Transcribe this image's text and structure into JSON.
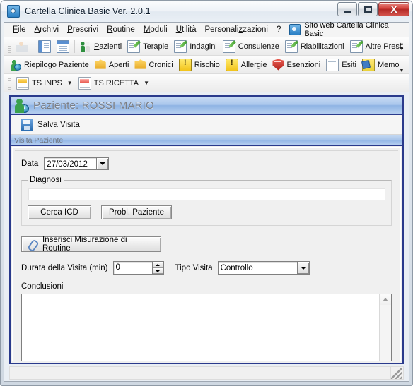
{
  "window": {
    "title": "Cartella Clinica Basic Ver. 2.0.1",
    "app_icon": "app-icon",
    "controls": {
      "minimize": "minimize-button",
      "maximize": "maximize-button",
      "close_glyph": "X"
    }
  },
  "menubar": {
    "items": [
      {
        "label": "File",
        "accel": "F"
      },
      {
        "label": "Archivi",
        "accel": "A"
      },
      {
        "label": "Prescrivi",
        "accel": "P"
      },
      {
        "label": "Routine",
        "accel": "R"
      },
      {
        "label": "Moduli",
        "accel": "M"
      },
      {
        "label": "Utilità",
        "accel": "U"
      },
      {
        "label": "Personalizzazioni",
        "accel": "z"
      },
      {
        "label": "?",
        "accel": ""
      }
    ],
    "web_link": "Sito web Cartella Clinica Basic"
  },
  "toolbar1": {
    "overflow_glyph": "»",
    "items": [
      {
        "label": "",
        "icon": "person-search-icon"
      },
      {
        "label": "",
        "icon": "panel-left-icon"
      },
      {
        "label": "",
        "icon": "panel-top-icon"
      },
      {
        "label": "Pazienti",
        "accel": "P",
        "icon": "people-icon"
      },
      {
        "label": "Terapie",
        "icon": "note-pencil-icon"
      },
      {
        "label": "Indagini",
        "icon": "note-pencil-icon"
      },
      {
        "label": "Consulenze",
        "icon": "note-pencil-icon"
      },
      {
        "label": "Riabilitazioni",
        "icon": "note-pencil-icon"
      },
      {
        "label": "Altre Prest.",
        "icon": "note-pencil-icon"
      }
    ]
  },
  "toolbar2": {
    "items": [
      {
        "label": "Riepilogo Paziente",
        "icon": "patient-summary-icon"
      },
      {
        "label": "Aperti",
        "icon": "folder-icon"
      },
      {
        "label": "Cronici",
        "icon": "folder-icon"
      },
      {
        "label": "Rischio",
        "icon": "warning-icon"
      },
      {
        "label": "Allergie",
        "icon": "warning-icon"
      },
      {
        "label": "Esenzioni",
        "icon": "shield-icon"
      },
      {
        "label": "Esiti",
        "icon": "document-icon"
      },
      {
        "label": "Memo",
        "icon": "memo-icon"
      }
    ]
  },
  "toolbar3": {
    "items": [
      {
        "label": "TS INPS",
        "icon": "card-yellow-icon",
        "has_dropdown": true
      },
      {
        "label": "TS RICETTA",
        "icon": "card-red-icon",
        "has_dropdown": true
      }
    ]
  },
  "patient_header": {
    "title": "Paziente: ROSSI MARIO",
    "icon": "patient-info-icon"
  },
  "save_bar": {
    "label": "Salva Visita",
    "accel": "V",
    "icon": "save-icon"
  },
  "tabstrip": {
    "active_tab": "Visita Paziente"
  },
  "form": {
    "data_label": "Data",
    "data_value": "27/03/2012",
    "diagnosi": {
      "group_title": "Diagnosi",
      "input_value": "",
      "input_placeholder": "",
      "buttons": [
        {
          "label": "Cerca ICD"
        },
        {
          "label": "Probl. Paziente"
        }
      ]
    },
    "routine_button": {
      "label": "Inserisci Misurazione di Routine",
      "icon": "clip-icon"
    },
    "durata_label": "Durata della Visita (min)",
    "durata_value": "0",
    "tipo_visita_label": "Tipo Visita",
    "tipo_visita_value": "Controllo",
    "conclusioni_label": "Conclusioni",
    "conclusioni_value": ""
  },
  "statusbar": {
    "text": ""
  }
}
